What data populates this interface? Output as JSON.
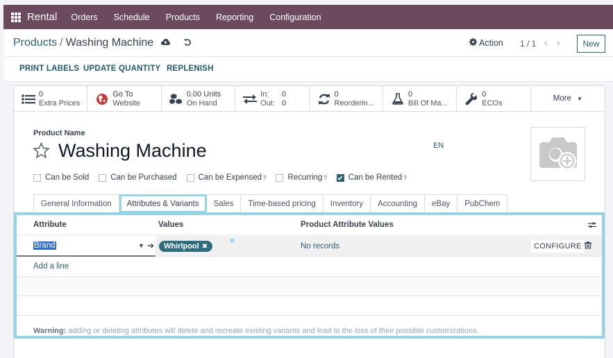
{
  "topbar": {
    "app_name": "Rental",
    "menu": [
      "Orders",
      "Schedule",
      "Products",
      "Reporting",
      "Configuration"
    ],
    "bg_color": "#6b4a60"
  },
  "controlbar": {
    "breadcrumb_parent": "Products",
    "breadcrumb_separator": "/",
    "breadcrumb_current": "Washing Machine",
    "action_label": "Action",
    "pager": "1 / 1",
    "new_label": "New"
  },
  "actionbar": {
    "buttons": [
      "PRINT LABELS",
      "UPDATE QUANTITY",
      "REPLENISH"
    ]
  },
  "stats": [
    {
      "icon": "list-icon",
      "value": "0",
      "label": "Extra Prices"
    },
    {
      "icon": "globe-icon",
      "value": "Go To",
      "label": "Website"
    },
    {
      "icon": "cubes-icon",
      "value": "0.00 Units",
      "label": "On Hand"
    },
    {
      "icon": "exchange-icon",
      "in_label": "In:",
      "in_value": "0",
      "out_label": "Out:",
      "out_value": "0"
    },
    {
      "icon": "refresh-icon",
      "value": "0",
      "label": "Reorderin..."
    },
    {
      "icon": "flask-icon",
      "value": "0",
      "label": "Bill Of Ma..."
    },
    {
      "icon": "wrench-icon",
      "value": "0",
      "label": "ECOs"
    },
    {
      "label": "More"
    }
  ],
  "form": {
    "product_name_label": "Product Name",
    "product_name": "Washing Machine",
    "lang": "EN",
    "checkboxes": [
      {
        "label": "Can be Sold",
        "checked": false,
        "help": ""
      },
      {
        "label": "Can be Purchased",
        "checked": false,
        "help": ""
      },
      {
        "label": "Can be Expensed",
        "checked": false,
        "help": "?"
      },
      {
        "label": "Recurring",
        "checked": false,
        "help": "?"
      },
      {
        "label": "Can be Rented",
        "checked": true,
        "help": "?"
      }
    ]
  },
  "tabs": [
    {
      "label": "General Information",
      "active": false
    },
    {
      "label": "Attributes & Variants",
      "active": true
    },
    {
      "label": "Sales",
      "active": false
    },
    {
      "label": "Time-based pricing",
      "active": false
    },
    {
      "label": "Inventory",
      "active": false
    },
    {
      "label": "Accounting",
      "active": false
    },
    {
      "label": "eBay",
      "active": false
    },
    {
      "label": "PubChem",
      "active": false
    }
  ],
  "attributes": {
    "columns": [
      "Attribute",
      "Values",
      "Product Attribute Values"
    ],
    "rows": [
      {
        "attribute": "Brand",
        "values": [
          "Whirlpool"
        ],
        "product_values": "No records",
        "configure_label": "CONFIGURE"
      }
    ],
    "add_line": "Add a line",
    "warning_label": "Warning:",
    "warning_text": " adding or deleting attributes will delete and recreate existing variants and lead to the loss of their possible customizations.",
    "highlight_color": "#93d4e6"
  }
}
